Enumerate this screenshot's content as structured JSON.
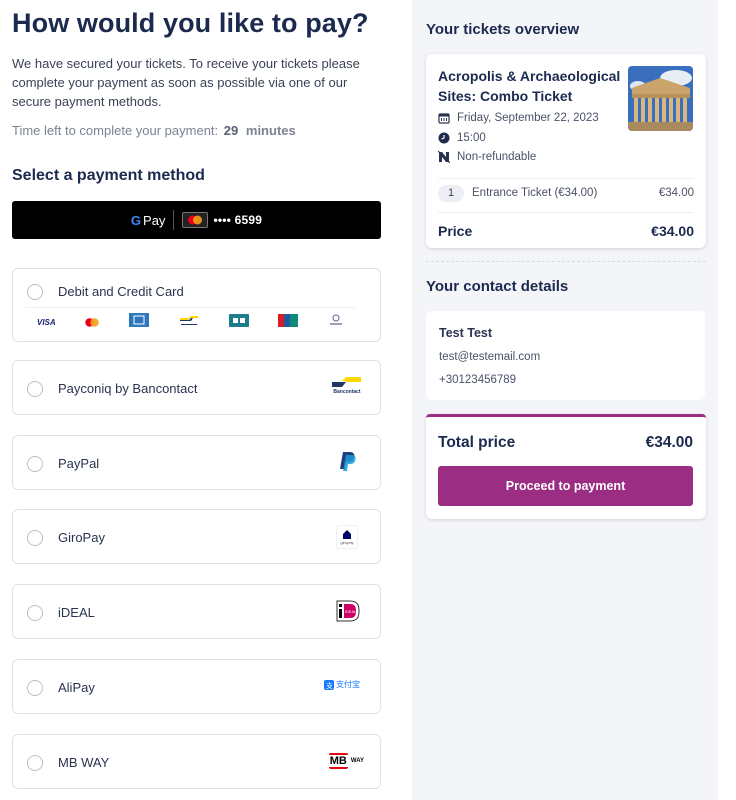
{
  "header": {
    "title": "How would you like to pay?",
    "intro": "We have secured your tickets. To receive your tickets please complete your payment as soon as possible via one of our secure payment methods.",
    "timer_label": "Time left to complete your payment:",
    "timer_value": "29",
    "timer_unit": "minutes"
  },
  "payment": {
    "section_title": "Select a payment method",
    "gpay": {
      "brand_g": "G",
      "brand_pay": "Pay",
      "card_icon": "mastercard-icon",
      "masked_number": "•••• 6599"
    },
    "methods": [
      {
        "label": "Debit and Credit Card",
        "icon": "credit-card-brands",
        "selected": false,
        "card_brands": [
          "VISA",
          "Mastercard",
          "American Express",
          "Bancontact",
          "Cartes Bancaires",
          "UnionPay",
          "Discover"
        ]
      },
      {
        "label": "Payconiq by Bancontact",
        "icon": "bancontact-logo",
        "logo_text": "Bancontact",
        "selected": false
      },
      {
        "label": "PayPal",
        "icon": "paypal-logo",
        "selected": false
      },
      {
        "label": "GiroPay",
        "icon": "giropay-logo",
        "logo_text": "giropay",
        "selected": false
      },
      {
        "label": "iDEAL",
        "icon": "ideal-logo",
        "logo_text": "iDEAL",
        "selected": false
      },
      {
        "label": "AliPay",
        "icon": "alipay-logo",
        "logo_text": "支付宝",
        "selected": false
      },
      {
        "label": "MB WAY",
        "icon": "mbway-logo",
        "logo_text_mb": "MB",
        "logo_text_way": "WAY",
        "selected": false
      }
    ]
  },
  "tickets_overview": {
    "title": "Your tickets overview",
    "product_name": "Acropolis & Archaeological Sites: Combo Ticket",
    "image_alt": "Parthenon on the Acropolis",
    "date": "Friday, September 22, 2023",
    "time": "15:00",
    "refund_policy": "Non-refundable",
    "line_items": [
      {
        "quantity": "1",
        "description": "Entrance Ticket (€34.00)",
        "amount": "€34.00"
      }
    ],
    "price_label": "Price",
    "price_value": "€34.00"
  },
  "contact": {
    "title": "Your contact details",
    "name": "Test Test",
    "email": "test@testemail.com",
    "phone": "+30123456789"
  },
  "total": {
    "label": "Total price",
    "value": "€34.00",
    "button_label": "Proceed to payment",
    "accent_color": "#9b2d82"
  }
}
